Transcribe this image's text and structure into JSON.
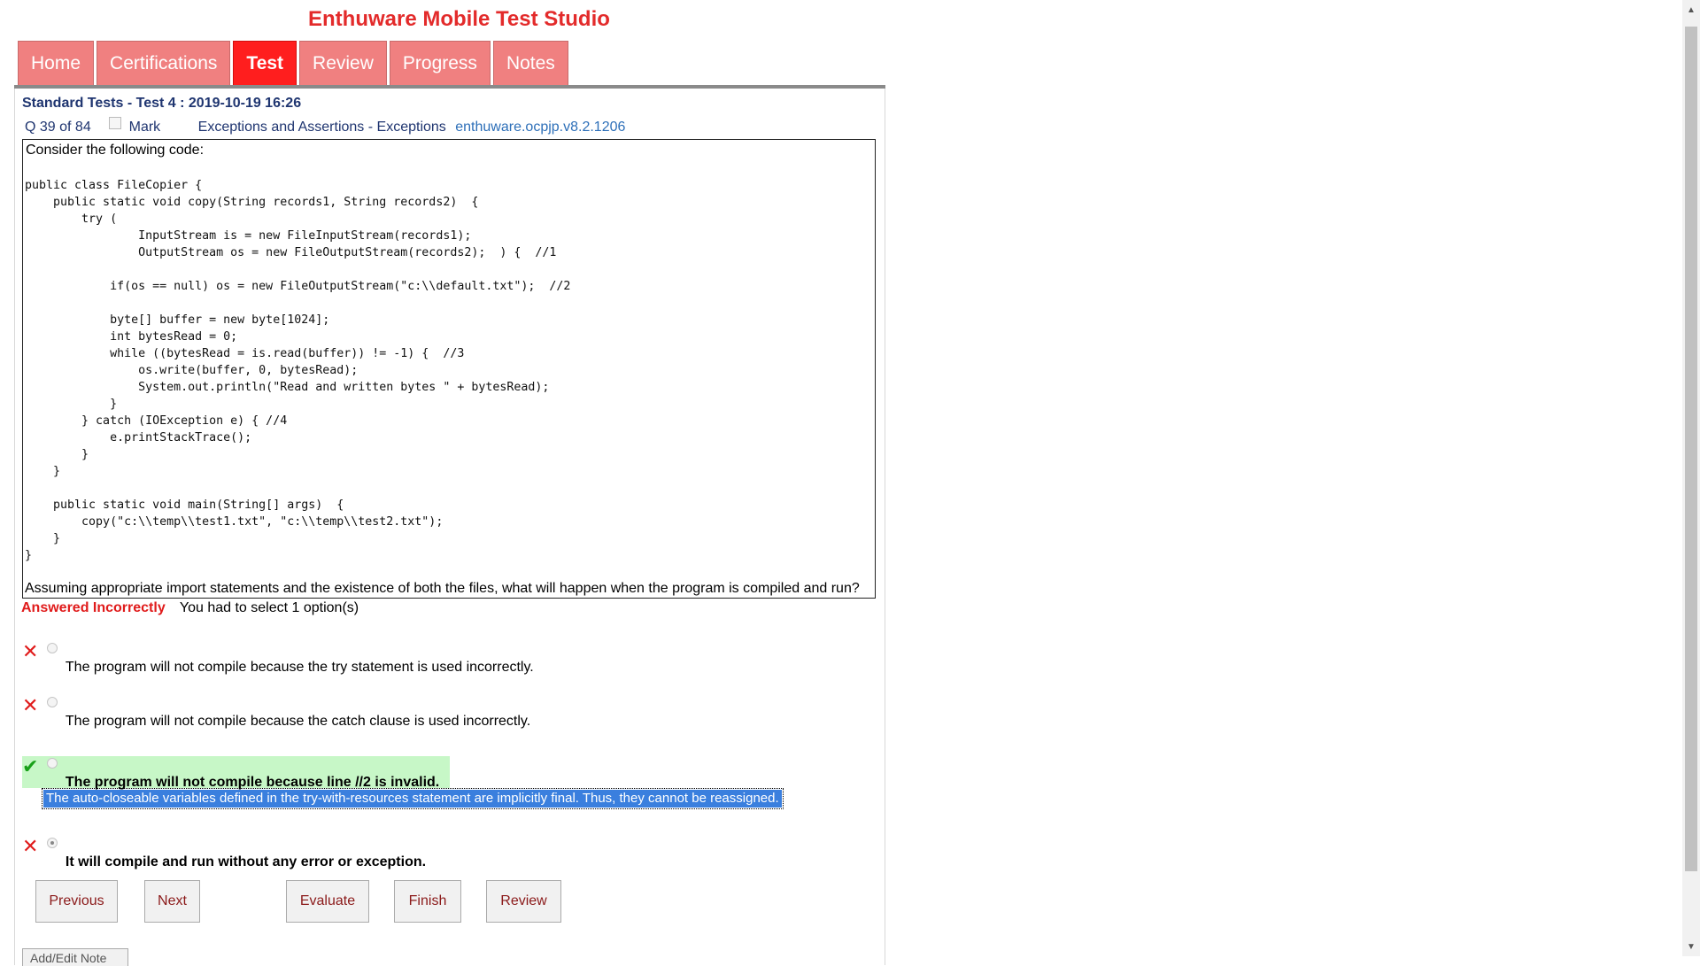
{
  "app_title": "Enthuware Mobile Test Studio",
  "tabs": [
    {
      "label": "Home"
    },
    {
      "label": "Certifications"
    },
    {
      "label": "Test"
    },
    {
      "label": "Review"
    },
    {
      "label": "Progress"
    },
    {
      "label": "Notes"
    }
  ],
  "active_tab": "Test",
  "test": {
    "name": "Standard Tests - Test 4 : 2019-10-19 16:26",
    "question_position": "Q 39 of 84",
    "mark_label": "Mark",
    "topic": "Exceptions and Assertions - Exceptions",
    "question_id": "enthuware.ocpjp.v8.2.1206"
  },
  "question": {
    "intro": "Consider the following code:",
    "code": "public class FileCopier {\n    public static void copy(String records1, String records2)  {\n        try (\n                InputStream is = new FileInputStream(records1);\n                OutputStream os = new FileOutputStream(records2);  ) {  //1\n\n            if(os == null) os = new FileOutputStream(\"c:\\\\default.txt\");  //2\n\n            byte[] buffer = new byte[1024];\n            int bytesRead = 0;\n            while ((bytesRead = is.read(buffer)) != -1) {  //3\n                os.write(buffer, 0, bytesRead);\n                System.out.println(\"Read and written bytes \" + bytesRead);\n            }\n        } catch (IOException e) { //4\n            e.printStackTrace();\n        }\n    }\n\n    public static void main(String[] args)  {\n        copy(\"c:\\\\temp\\\\test1.txt\", \"c:\\\\temp\\\\test2.txt\");\n    }\n}",
    "outro": "Assuming appropriate import statements and the existence of both the files, what will happen when the program is compiled and run?"
  },
  "result": {
    "status": "Answered Incorrectly",
    "instruction": "You had to select 1 option(s)"
  },
  "options": [
    {
      "text": "The program will not compile because the try statement is used incorrectly.",
      "mark": "✕",
      "selected": false,
      "correct": false
    },
    {
      "text": "The program will not compile because the catch clause is used incorrectly.",
      "mark": "✕",
      "selected": false,
      "correct": false
    },
    {
      "text": "The program will not compile because line //2 is invalid.",
      "mark": "✔",
      "selected": false,
      "correct": true
    },
    {
      "text": "It will compile and run without any error or exception.",
      "mark": "✕",
      "selected": true,
      "correct": false
    }
  ],
  "explanation": "The auto-closeable variables defined in the try-with-resources statement are implicitly final. Thus, they cannot be reassigned.",
  "buttons": {
    "previous": "Previous",
    "next": "Next",
    "evaluate": "Evaluate",
    "finish": "Finish",
    "review": "Review",
    "add_edit_note": "Add/Edit Note"
  },
  "colors": {
    "tab": "#f08080",
    "tab_active": "#ff1e1e",
    "title": "#e32b2b",
    "correct_bg": "#c7f7c7",
    "selection": "#3a7fde"
  }
}
